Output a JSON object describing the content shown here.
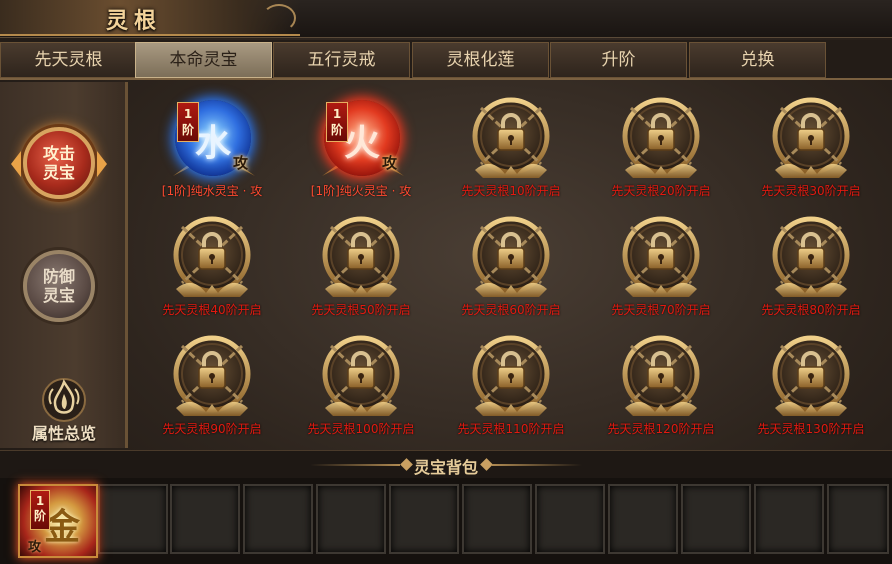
{
  "window": {
    "title": "灵根"
  },
  "tabs": [
    {
      "label": "先天灵根",
      "active": false
    },
    {
      "label": "本命灵宝",
      "active": true
    },
    {
      "label": "五行灵戒",
      "active": false
    },
    {
      "label": "灵根化莲",
      "active": false
    },
    {
      "label": "升阶",
      "active": false
    },
    {
      "label": "兑换",
      "active": false
    }
  ],
  "sidebar": {
    "attack": {
      "line1": "攻击",
      "line2": "灵宝"
    },
    "defense": {
      "line1": "防御",
      "line2": "灵宝"
    },
    "overview": {
      "label": "属性总览",
      "icon": "flame-emblem-icon"
    }
  },
  "slots": [
    {
      "label": "[1阶]纯水灵宝 · 攻",
      "state": "owned",
      "element": "水",
      "tier": "1阶",
      "tag": "攻"
    },
    {
      "label": "[1阶]纯火灵宝 · 攻",
      "state": "owned",
      "element": "火",
      "tier": "1阶",
      "tag": "攻"
    },
    {
      "label": "先天灵根10阶开启",
      "state": "locked"
    },
    {
      "label": "先天灵根20阶开启",
      "state": "locked"
    },
    {
      "label": "先天灵根30阶开启",
      "state": "locked"
    },
    {
      "label": "先天灵根40阶开启",
      "state": "locked"
    },
    {
      "label": "先天灵根50阶开启",
      "state": "locked"
    },
    {
      "label": "先天灵根60阶开启",
      "state": "locked"
    },
    {
      "label": "先天灵根70阶开启",
      "state": "locked"
    },
    {
      "label": "先天灵根80阶开启",
      "state": "locked"
    },
    {
      "label": "先天灵根90阶开启",
      "state": "locked"
    },
    {
      "label": "先天灵根100阶开启",
      "state": "locked"
    },
    {
      "label": "先天灵根110阶开启",
      "state": "locked"
    },
    {
      "label": "先天灵根120阶开启",
      "state": "locked"
    },
    {
      "label": "先天灵根130阶开启",
      "state": "locked"
    }
  ],
  "bag": {
    "title": "灵宝背包",
    "item": {
      "tier": "1阶",
      "element": "金",
      "tag": "攻"
    }
  },
  "colors": {
    "lock_text": "#e21a10",
    "accent_gold": "#c9a062",
    "water_orb": "#2f6ee0",
    "fire_orb": "#e23a20"
  }
}
